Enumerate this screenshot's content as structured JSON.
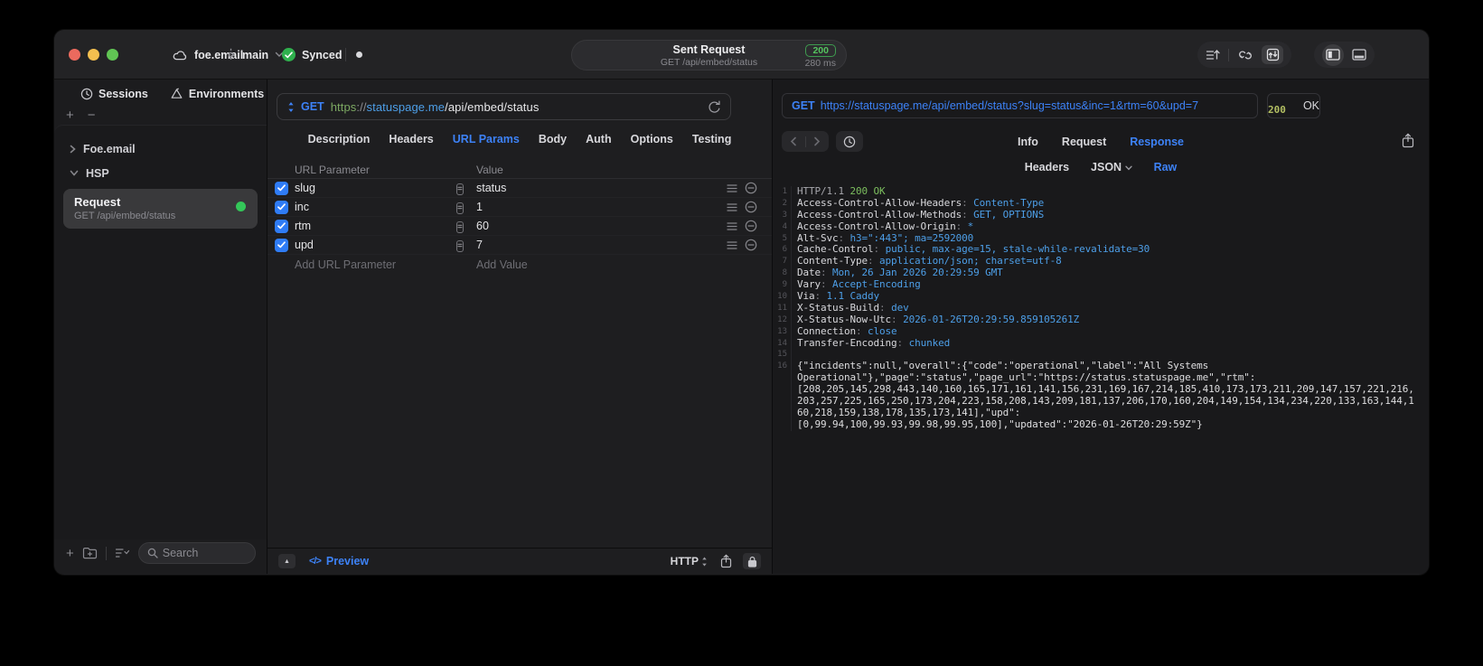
{
  "titlebar": {
    "project": "foe.email",
    "branch": "main",
    "sync_status": "Synced",
    "center": {
      "title": "Sent Request",
      "subtitle": "GET /api/embed/status",
      "status_code": "200",
      "duration": "280 ms"
    }
  },
  "sidebar": {
    "tabs": [
      {
        "label": "Sessions"
      },
      {
        "label": "Environments"
      }
    ],
    "tree": [
      {
        "label": "Foe.email",
        "expanded": false
      },
      {
        "label": "HSP",
        "expanded": true
      }
    ],
    "request_item": {
      "title": "Request",
      "subtitle": "GET /api/embed/status"
    },
    "search_placeholder": "Search"
  },
  "request_editor": {
    "method": "GET",
    "url": {
      "scheme": "https",
      "separator": "://",
      "host": "statuspage.me",
      "path": "/api/embed/status"
    },
    "tabs": [
      "Description",
      "Headers",
      "URL Params",
      "Body",
      "Auth",
      "Options",
      "Testing"
    ],
    "active_tab": "URL Params",
    "param_table": {
      "columns": [
        "URL Parameter",
        "Value"
      ],
      "rows": [
        {
          "name": "slug",
          "value": "status",
          "enabled": true
        },
        {
          "name": "inc",
          "value": "1",
          "enabled": true
        },
        {
          "name": "rtm",
          "value": "60",
          "enabled": true
        },
        {
          "name": "upd",
          "value": "7",
          "enabled": true
        }
      ],
      "add_row": {
        "name_placeholder": "Add URL Parameter",
        "value_placeholder": "Add Value"
      }
    },
    "footer": {
      "preview_label": "Preview",
      "protocol_label": "HTTP"
    }
  },
  "response_viewer": {
    "request_line": {
      "method": "GET",
      "url": "https://statuspage.me/api/embed/status?slug=status&inc=1&rtm=60&upd=7"
    },
    "status": {
      "code": "200",
      "text": "OK"
    },
    "tabs": [
      "Info",
      "Request",
      "Response"
    ],
    "active_tab": "Response",
    "subtabs": [
      "Headers",
      "JSON",
      "Raw"
    ],
    "active_subtab": "Raw",
    "raw": {
      "status_line": {
        "protocol": "HTTP/1.1",
        "status": "200 OK"
      },
      "headers": [
        {
          "name": "Access-Control-Allow-Headers",
          "value": "Content-Type"
        },
        {
          "name": "Access-Control-Allow-Methods",
          "value": "GET, OPTIONS"
        },
        {
          "name": "Access-Control-Allow-Origin",
          "value": "*"
        },
        {
          "name": "Alt-Svc",
          "value": "h3=\":443\"; ma=2592000"
        },
        {
          "name": "Cache-Control",
          "value": "public, max-age=15, stale-while-revalidate=30"
        },
        {
          "name": "Content-Type",
          "value": "application/json; charset=utf-8"
        },
        {
          "name": "Date",
          "value": "Mon, 26 Jan 2026 20:29:59 GMT"
        },
        {
          "name": "Vary",
          "value": "Accept-Encoding"
        },
        {
          "name": "Via",
          "value": "1.1 Caddy"
        },
        {
          "name": "X-Status-Build",
          "value": "dev"
        },
        {
          "name": "X-Status-Now-Utc",
          "value": "2026-01-26T20:29:59.859105261Z"
        },
        {
          "name": "Connection",
          "value": "close"
        },
        {
          "name": "Transfer-Encoding",
          "value": "chunked"
        }
      ],
      "body_lines": [
        "{\"incidents\":null,\"overall\":{\"code\":\"operational\",\"label\":\"All Systems",
        "Operational\"},\"page\":\"status\",\"page_url\":\"https://status.statuspage.me\",\"rtm\":",
        "[208,205,145,298,443,140,160,165,171,161,141,156,231,169,167,214,185,410,173,173,211,209,147,157,221,216,",
        "203,257,225,165,250,173,204,223,158,208,143,209,181,137,206,170,160,204,149,154,134,234,220,133,163,144,1",
        "60,218,159,138,178,135,173,141],\"upd\":",
        "[0,99.94,100,99.93,99.98,99.95,100],\"updated\":\"2026-01-26T20:29:59Z\"}"
      ]
    }
  },
  "icons": {
    "plus": "+",
    "minus": "−",
    "collapse": "▲",
    "code": "</>",
    "equals": "="
  },
  "colors": {
    "accent_blue": "#3D82F7",
    "code_value_blue": "#4D9FE8",
    "status_green": "#34C759",
    "badge_green": "#55C45F",
    "ok_green": "#7CBE5E",
    "status_olive": "#B2BE62",
    "traffic_red": "#EC6A5E",
    "traffic_yellow": "#F4BF4F",
    "traffic_green": "#61C554"
  }
}
